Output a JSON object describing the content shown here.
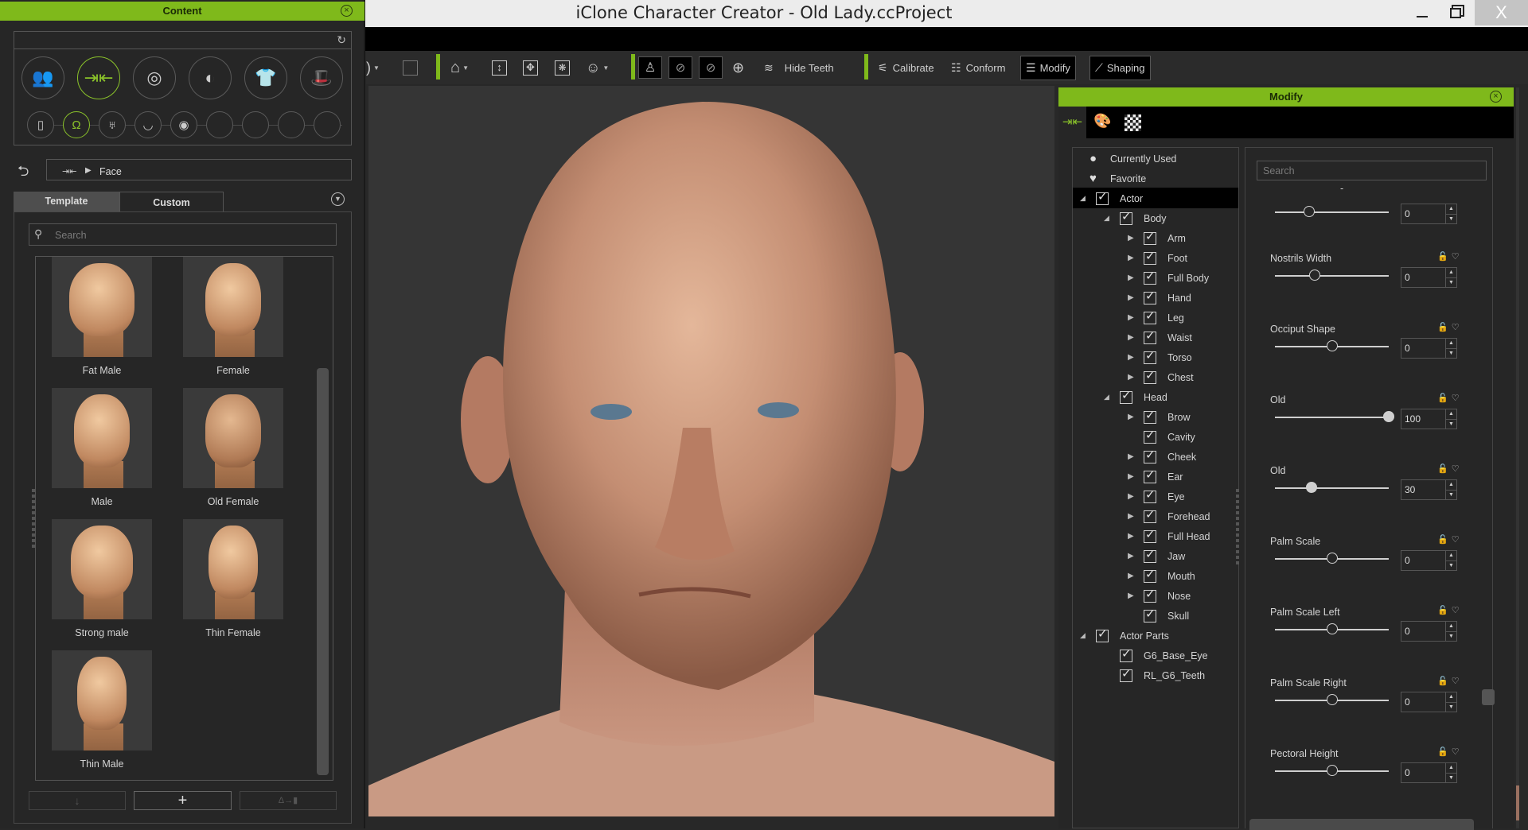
{
  "window": {
    "title": "iClone Character Creator - Old Lady.ccProject",
    "controls": {
      "minimize": "–",
      "maximize": "❐",
      "close": "X"
    }
  },
  "toolbar": {
    "hide_teeth": "Hide Teeth",
    "calibrate": "Calibrate",
    "conform": "Conform",
    "modify": "Modify",
    "shaping": "Shaping",
    "accent_color": "#7fb91b"
  },
  "content_panel": {
    "title": "Content",
    "breadcrumb": {
      "root_icon": "morph-icon",
      "current": "Face"
    },
    "tabs": [
      {
        "label": "Template",
        "active": true
      },
      {
        "label": "Custom",
        "active": false
      }
    ],
    "search_placeholder": "Search",
    "categories_large": [
      "characters-icon",
      "morph-icon",
      "material-icon",
      "head-icon",
      "clothing-icon",
      "accessory-icon"
    ],
    "categories_small": [
      "full-body-icon",
      "head-icon",
      "body-icon",
      "teeth-icon",
      "eye-icon",
      "",
      "",
      "",
      ""
    ],
    "templates": [
      {
        "label": "Fat Male"
      },
      {
        "label": "Female"
      },
      {
        "label": "Male"
      },
      {
        "label": "Old Female"
      },
      {
        "label": "Strong male"
      },
      {
        "label": "Thin Female"
      },
      {
        "label": "Thin Male"
      }
    ],
    "footer_buttons": [
      "apply-down",
      "add",
      "delta-apply"
    ]
  },
  "modify_panel": {
    "title": "Modify",
    "tree": [
      {
        "label": "Currently Used",
        "level": 0,
        "icon": "circle"
      },
      {
        "label": "Favorite",
        "level": 0,
        "icon": "heart"
      },
      {
        "label": "Actor",
        "level": 0,
        "expanded": true,
        "checked": true,
        "selected": true
      },
      {
        "label": "Body",
        "level": 1,
        "expanded": true,
        "checked": true
      },
      {
        "label": "Arm",
        "level": 2,
        "collapsed": true,
        "checked": true
      },
      {
        "label": "Foot",
        "level": 2,
        "collapsed": true,
        "checked": true
      },
      {
        "label": "Full Body",
        "level": 2,
        "collapsed": true,
        "checked": true
      },
      {
        "label": "Hand",
        "level": 2,
        "collapsed": true,
        "checked": true
      },
      {
        "label": "Leg",
        "level": 2,
        "collapsed": true,
        "checked": true
      },
      {
        "label": "Waist",
        "level": 2,
        "collapsed": true,
        "checked": true
      },
      {
        "label": "Torso",
        "level": 2,
        "collapsed": true,
        "checked": true
      },
      {
        "label": "Chest",
        "level": 2,
        "collapsed": true,
        "checked": true
      },
      {
        "label": "Head",
        "level": 1,
        "expanded": true,
        "checked": true
      },
      {
        "label": "Brow",
        "level": 2,
        "collapsed": true,
        "checked": true
      },
      {
        "label": "Cavity",
        "level": 2,
        "checked": true
      },
      {
        "label": "Cheek",
        "level": 2,
        "collapsed": true,
        "checked": true
      },
      {
        "label": "Ear",
        "level": 2,
        "collapsed": true,
        "checked": true
      },
      {
        "label": "Eye",
        "level": 2,
        "collapsed": true,
        "checked": true
      },
      {
        "label": "Forehead",
        "level": 2,
        "collapsed": true,
        "checked": true
      },
      {
        "label": "Full Head",
        "level": 2,
        "collapsed": true,
        "checked": true
      },
      {
        "label": "Jaw",
        "level": 2,
        "collapsed": true,
        "checked": true
      },
      {
        "label": "Mouth",
        "level": 2,
        "collapsed": true,
        "checked": true
      },
      {
        "label": "Nose",
        "level": 2,
        "collapsed": true,
        "checked": true
      },
      {
        "label": "Skull",
        "level": 2,
        "checked": true
      },
      {
        "label": "Actor Parts",
        "level": 0,
        "expanded": true,
        "checked": true
      },
      {
        "label": "G6_Base_Eye",
        "level": 1,
        "checked": true
      },
      {
        "label": "RL_G6_Teeth",
        "level": 1,
        "checked": true
      }
    ],
    "search_placeholder": "Search",
    "sliders": [
      {
        "label": "-",
        "value": "0",
        "position_fraction": 0.3
      },
      {
        "label": "Nostrils Width",
        "value": "0",
        "position_fraction": 0.35
      },
      {
        "label": "Occiput Shape",
        "value": "0",
        "position_fraction": 0.5
      },
      {
        "label": "Old",
        "value": "100",
        "position_fraction": 1.0,
        "filled": true
      },
      {
        "label": "Old",
        "value": "30",
        "position_fraction": 0.32,
        "filled": true
      },
      {
        "label": "Palm Scale",
        "value": "0",
        "position_fraction": 0.5
      },
      {
        "label": "Palm Scale Left",
        "value": "0",
        "position_fraction": 0.5
      },
      {
        "label": "Palm Scale Right",
        "value": "0",
        "position_fraction": 0.5
      },
      {
        "label": "Pectoral Height",
        "value": "0",
        "position_fraction": 0.5
      }
    ]
  }
}
